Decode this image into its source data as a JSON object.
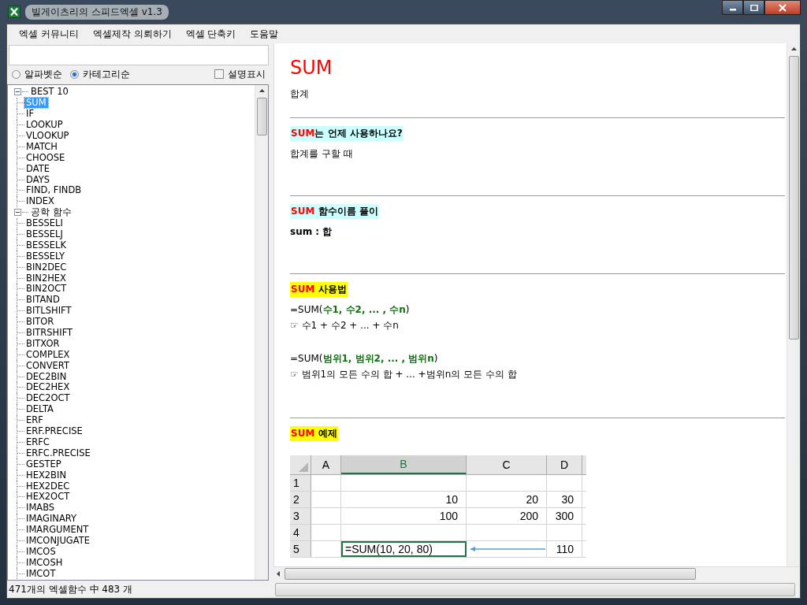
{
  "window": {
    "title": "빌게이츠리의 스피드엑셀 v1.3"
  },
  "menu": [
    "엑셀 커뮤니티",
    "엑셀제작 의뢰하기",
    "엑셀 단축키",
    "도움말"
  ],
  "sort_options": [
    {
      "label": "알파벳순",
      "selected": false
    },
    {
      "label": "카테고리순",
      "selected": true
    }
  ],
  "show_description": {
    "label": "설명표시",
    "checked": false
  },
  "tree": [
    {
      "label": "BEST 10",
      "expanded": true,
      "selected": false,
      "children": [
        {
          "label": "SUM",
          "selected": true
        },
        {
          "label": "IF",
          "selected": false
        },
        {
          "label": "LOOKUP",
          "selected": false
        },
        {
          "label": "VLOOKUP",
          "selected": false
        },
        {
          "label": "MATCH",
          "selected": false
        },
        {
          "label": "CHOOSE",
          "selected": false
        },
        {
          "label": "DATE",
          "selected": false
        },
        {
          "label": "DAYS",
          "selected": false
        },
        {
          "label": "FIND, FINDB",
          "selected": false
        },
        {
          "label": "INDEX",
          "selected": false
        }
      ]
    },
    {
      "label": "공학 함수",
      "expanded": true,
      "selected": false,
      "children": [
        {
          "label": "BESSELI",
          "selected": false
        },
        {
          "label": "BESSELJ",
          "selected": false
        },
        {
          "label": "BESSELK",
          "selected": false
        },
        {
          "label": "BESSELY",
          "selected": false
        },
        {
          "label": "BIN2DEC",
          "selected": false
        },
        {
          "label": "BIN2HEX",
          "selected": false
        },
        {
          "label": "BIN2OCT",
          "selected": false
        },
        {
          "label": "BITAND",
          "selected": false
        },
        {
          "label": "BITLSHIFT",
          "selected": false
        },
        {
          "label": "BITOR",
          "selected": false
        },
        {
          "label": "BITRSHIFT",
          "selected": false
        },
        {
          "label": "BITXOR",
          "selected": false
        },
        {
          "label": "COMPLEX",
          "selected": false
        },
        {
          "label": "CONVERT",
          "selected": false
        },
        {
          "label": "DEC2BIN",
          "selected": false
        },
        {
          "label": "DEC2HEX",
          "selected": false
        },
        {
          "label": "DEC2OCT",
          "selected": false
        },
        {
          "label": "DELTA",
          "selected": false
        },
        {
          "label": "ERF",
          "selected": false
        },
        {
          "label": "ERF.PRECISE",
          "selected": false
        },
        {
          "label": "ERFC",
          "selected": false
        },
        {
          "label": "ERFC.PRECISE",
          "selected": false
        },
        {
          "label": "GESTEP",
          "selected": false
        },
        {
          "label": "HEX2BIN",
          "selected": false
        },
        {
          "label": "HEX2DEC",
          "selected": false
        },
        {
          "label": "HEX2OCT",
          "selected": false
        },
        {
          "label": "IMABS",
          "selected": false
        },
        {
          "label": "IMAGINARY",
          "selected": false
        },
        {
          "label": "IMARGUMENT",
          "selected": false
        },
        {
          "label": "IMCONJUGATE",
          "selected": false
        },
        {
          "label": "IMCOS",
          "selected": false
        },
        {
          "label": "IMCOSH",
          "selected": false
        },
        {
          "label": "IMCOT",
          "selected": false
        }
      ]
    }
  ],
  "content": {
    "title": "SUM",
    "subtitle": "합계",
    "sections": [
      {
        "kind": "text",
        "name": "SUM",
        "heading": "는 언제 사용하나요?",
        "color": "#ccffff",
        "lines": [
          "합계를 구할 때"
        ]
      },
      {
        "kind": "bold",
        "name": "SUM",
        "heading": " 함수이름 풀이",
        "color": "#ccffff",
        "lines": [
          "sum : 합"
        ]
      },
      {
        "kind": "usage",
        "name": "SUM",
        "heading": " 사용법",
        "color": "#ffff00",
        "formulas": [
          {
            "prefix": "=SUM(",
            "args": "수1, 수2, ... , 수n",
            "suffix": ")",
            "hand": "☞",
            "note": "수1 + 수2 + ... +  수n"
          },
          {
            "prefix": "=SUM(",
            "args": "범위1, 범위2, ... , 범위n",
            "suffix": ")",
            "hand": "☞",
            "note": "범위1의 모든 수의 합 + ... +범위n의 모든 수의 합"
          }
        ]
      },
      {
        "kind": "example",
        "name": "SUM",
        "heading": " 예제",
        "color": "#ffff00",
        "sheet": {
          "columns": [
            {
              "label": "A",
              "selected": false
            },
            {
              "label": "B",
              "selected": true
            },
            {
              "label": "C",
              "selected": false
            },
            {
              "label": "D",
              "selected": false
            }
          ],
          "rows": [
            {
              "label": "1",
              "cells": [
                "",
                "",
                "",
                ""
              ]
            },
            {
              "label": "2",
              "cells": [
                "",
                "10",
                "20",
                "30"
              ]
            },
            {
              "label": "3",
              "cells": [
                "",
                "100",
                "200",
                "300"
              ]
            },
            {
              "label": "4",
              "cells": [
                "",
                "",
                "",
                ""
              ]
            },
            {
              "label": "5",
              "cells": [
                "",
                "=SUM(10, 20, 80)",
                "",
                "110"
              ]
            }
          ]
        }
      }
    ]
  },
  "status_bar": {
    "text": "471개의 엑셀함수 中 483 개"
  },
  "progress": {
    "level": 0
  }
}
